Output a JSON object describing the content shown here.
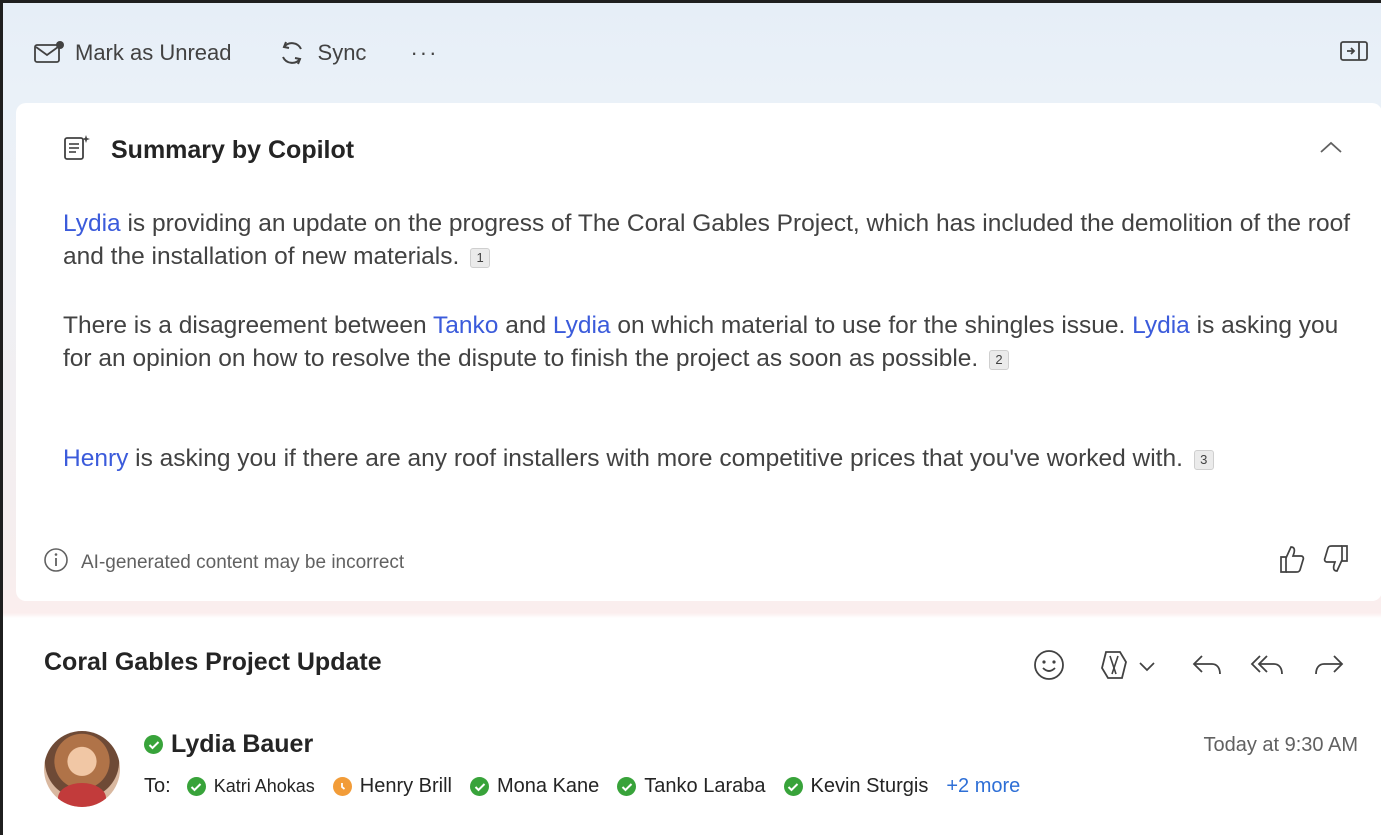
{
  "toolbar": {
    "mark_unread_label": "Mark as Unread",
    "sync_label": "Sync",
    "more_label": "···"
  },
  "summary": {
    "title": "Summary by Copilot",
    "paragraphs": [
      {
        "p1_name": "Lydia",
        "p1_text": " is providing an update on the progress of The Coral Gables Project, which has included the demolition of the roof and the installation of new materials.",
        "p1_cite": "1"
      },
      {
        "p2_a": "There is a disagreement between ",
        "p2_name1": "Tanko",
        "p2_b": " and ",
        "p2_name2": "Lydia",
        "p2_c": " on which material to use for the shingles issue. ",
        "p2_name3": "Lydia",
        "p2_d": " is asking you for an opinion on how to resolve the dispute to finish the project as soon as possible.",
        "p2_cite": "2"
      },
      {
        "p3_name": "Henry",
        "p3_text": " is asking you if there are any roof installers with more competitive prices that you've worked with.",
        "p3_cite": "3"
      }
    ],
    "disclaimer": "AI-generated content may be incorrect"
  },
  "email": {
    "subject": "Coral Gables Project Update",
    "sender": "Lydia Bauer",
    "time": "Today at 9:30 AM",
    "to_label": "To:",
    "recipients": [
      {
        "name": "Katri Ahokas",
        "status": "available"
      },
      {
        "name": "Henry Brill",
        "status": "away"
      },
      {
        "name": "Mona Kane",
        "status": "available"
      },
      {
        "name": "Tanko Laraba",
        "status": "available"
      },
      {
        "name": "Kevin Sturgis",
        "status": "available"
      }
    ],
    "more_recipients": "+2 more"
  },
  "colors": {
    "accent_link": "#3b5bdb",
    "available": "#38a33a",
    "away": "#f29c38",
    "more_link": "#2e6fd6"
  }
}
